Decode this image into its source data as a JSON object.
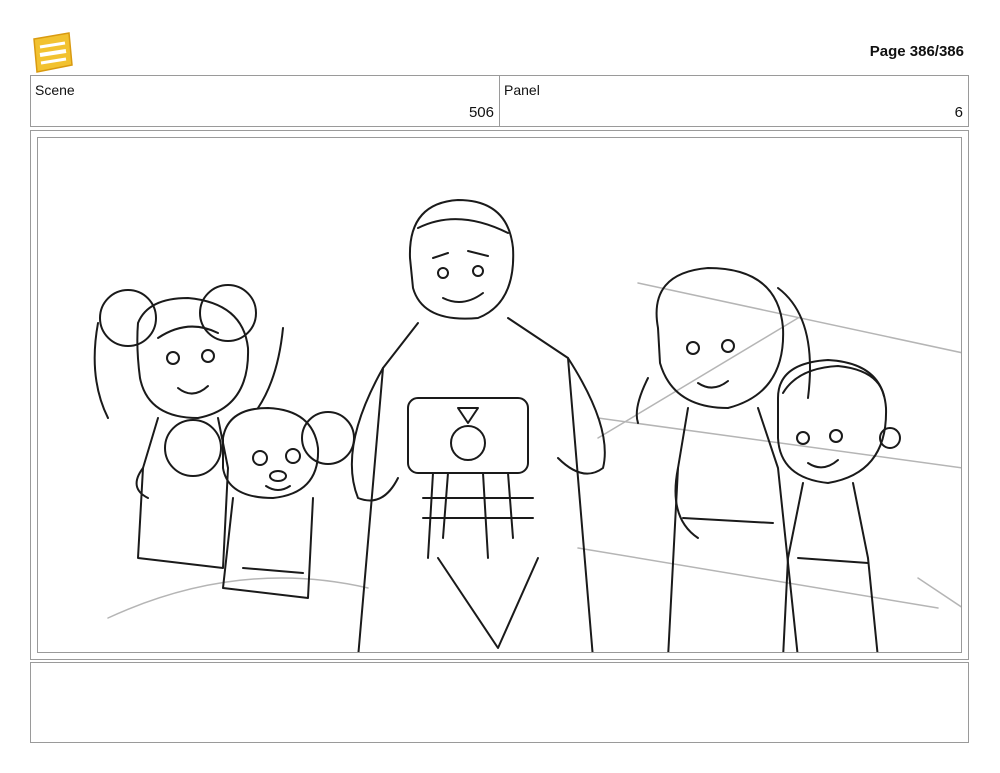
{
  "header": {
    "page_label": "Page 386/386",
    "logo_icon": "young-jedi-adventures-logo-icon",
    "logo_color": "#F2C230"
  },
  "scene": {
    "label": "Scene",
    "value": "506"
  },
  "panel": {
    "label": "Panel",
    "value": "6"
  },
  "colors": {
    "border": "#9a9a9a",
    "ink": "#1a1a1a",
    "guide_lines": "#b5b5b5"
  }
}
